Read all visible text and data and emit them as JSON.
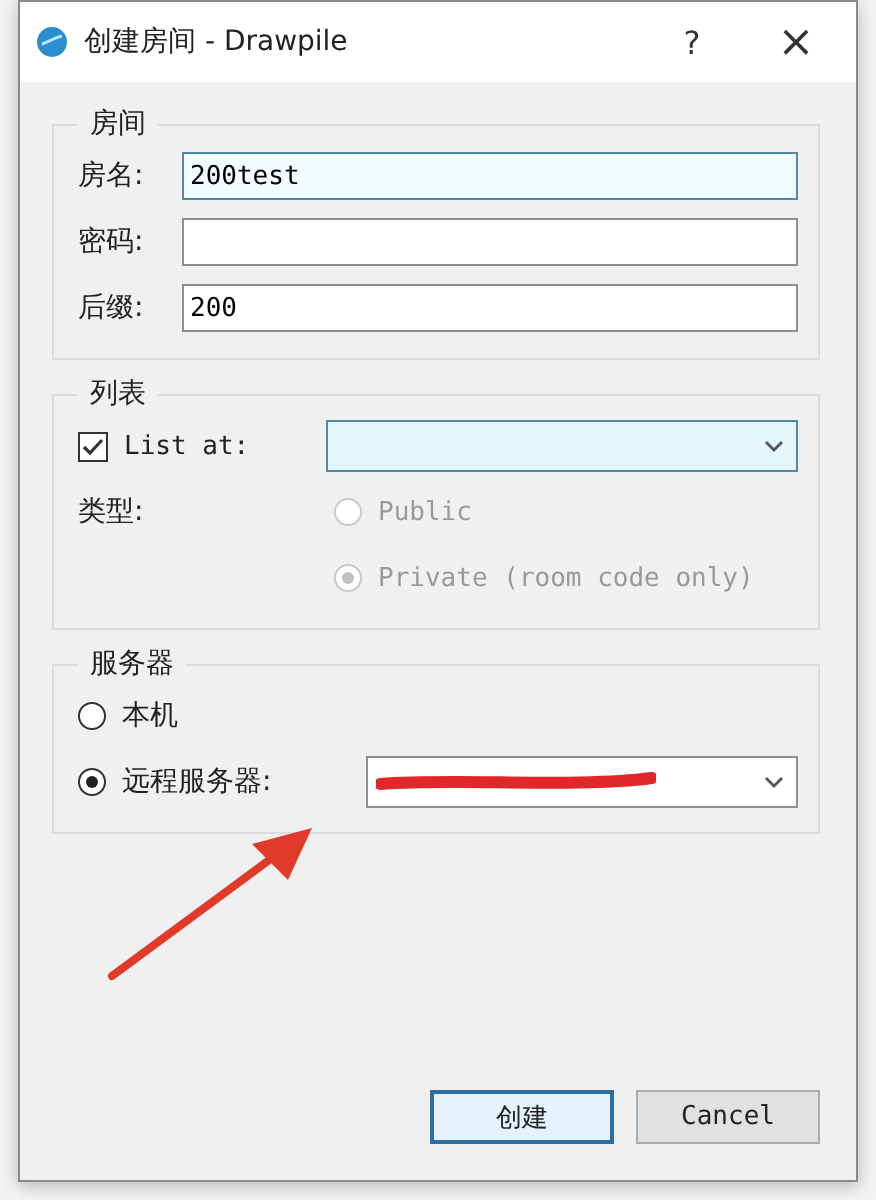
{
  "window": {
    "title": "创建房间 - Drawpile",
    "help": "?",
    "close": "×"
  },
  "room": {
    "title": "房间",
    "fields": [
      {
        "label": "房名:",
        "value": "200test",
        "focused": true
      },
      {
        "label": "密码:",
        "focused": false
      },
      {
        "label": "后缀:",
        "value": "200",
        "focused": false
      }
    ]
  },
  "listing": {
    "title": "列表",
    "list_at": {
      "label": "List at:",
      "checked": true
    },
    "type_label": "类型:",
    "types": [
      {
        "label": "Public",
        "selected": false,
        "disabled": true
      },
      {
        "label": "Private (room code only)",
        "selected": true,
        "disabled": true
      }
    ]
  },
  "server": {
    "title": "服务器",
    "options": [
      {
        "label": "本机",
        "selected": false
      },
      {
        "label": "远程服务器:",
        "selected": true
      }
    ]
  },
  "buttons": [
    {
      "label": "创建",
      "default": true
    },
    {
      "label": "Cancel",
      "default": false
    }
  ]
}
